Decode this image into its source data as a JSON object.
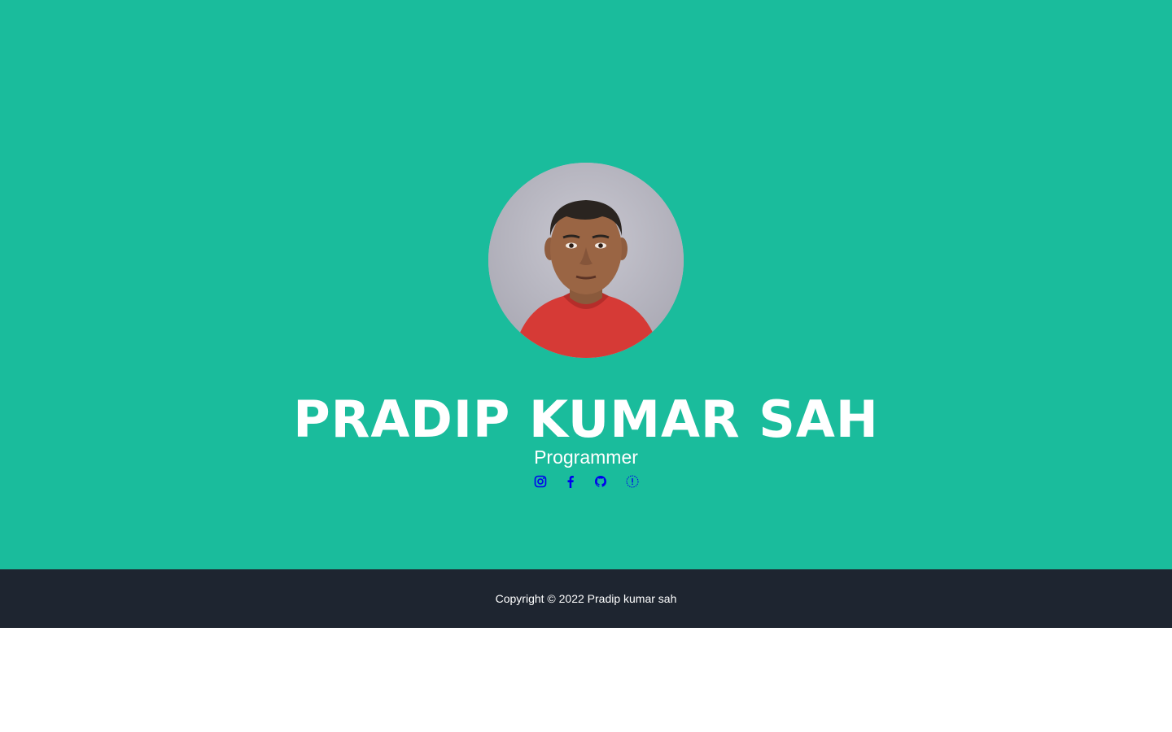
{
  "profile": {
    "name": "PRADIP KUMAR SAH",
    "role": "Programmer",
    "avatar_alt": "Portrait photo of Pradip Kumar Sah"
  },
  "social": [
    {
      "icon": "instagram-icon",
      "color": "#0000ee"
    },
    {
      "icon": "facebook-icon",
      "color": "#0000ee"
    },
    {
      "icon": "github-icon",
      "color": "#0000ee"
    },
    {
      "icon": "broken-link-icon",
      "color": "#0000ee"
    }
  ],
  "footer": {
    "copyright": "Copyright © 2022 Pradip kumar sah"
  },
  "colors": {
    "hero_background": "#1abc9c",
    "footer_background": "#1e2530",
    "text": "#ffffff",
    "link": "#0000ee"
  }
}
